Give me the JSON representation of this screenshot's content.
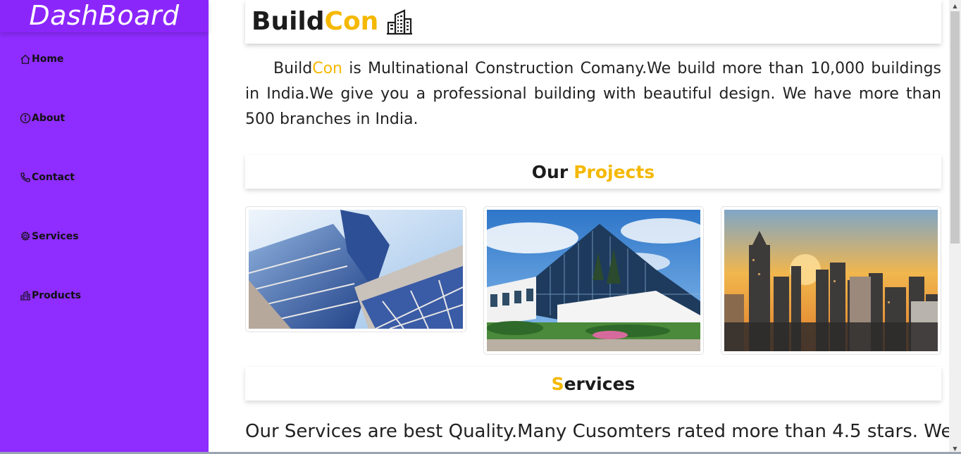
{
  "sidebar": {
    "brand": "DashBoard",
    "items": [
      {
        "label": "Home",
        "icon": "home-icon"
      },
      {
        "label": "About",
        "icon": "info-icon"
      },
      {
        "label": "Contact",
        "icon": "phone-icon"
      },
      {
        "label": "Services",
        "icon": "gear-icon"
      },
      {
        "label": "Products",
        "icon": "buildings-icon"
      }
    ]
  },
  "header": {
    "title_part1": "Build",
    "title_part2": "Con",
    "icon": "building-icon"
  },
  "intro": {
    "brand_part1": "Build",
    "brand_part2": "Con",
    "text": " is Multinational Construction Comany.We build more than 10,000 buildings in India.We give you a professional building with beautiful design. We have more than 500 branches in India."
  },
  "projects": {
    "heading_part1": "Our ",
    "heading_part2": "Projects",
    "images": [
      "glass-skyscraper-photo",
      "office-building-photo",
      "city-skyline-sunset-photo"
    ]
  },
  "services": {
    "heading_part1": "S",
    "heading_part2": "ervices",
    "text": "Our Services are best Quality.Many Cusomters rated more than 4.5 stars. We"
  },
  "colors": {
    "sidebar": "#8f2cff",
    "accent": "#f5b800",
    "text": "#222222"
  }
}
